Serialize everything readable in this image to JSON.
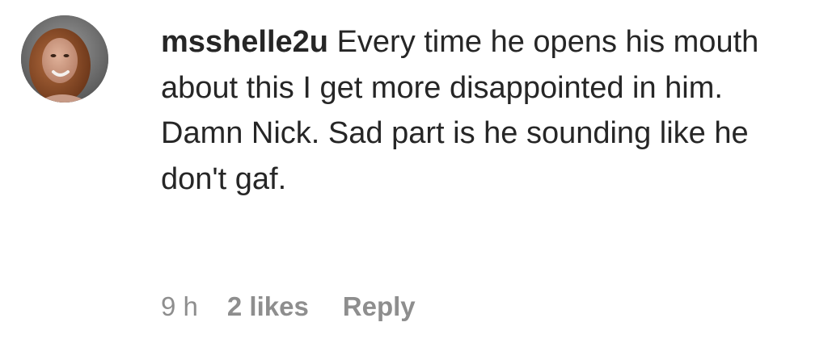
{
  "comment": {
    "username": "msshelle2u",
    "text": "Every time he opens his mouth about this I get more disappointed in him. Damn Nick. Sad part is he sounding like he don't gaf.",
    "timestamp": "9 h",
    "likes_label": "2 likes",
    "reply_label": "Reply",
    "avatar_icon": "profile-photo-icon"
  },
  "colors": {
    "text": "#262626",
    "secondary_text": "#8e8e8e",
    "background": "#ffffff"
  }
}
